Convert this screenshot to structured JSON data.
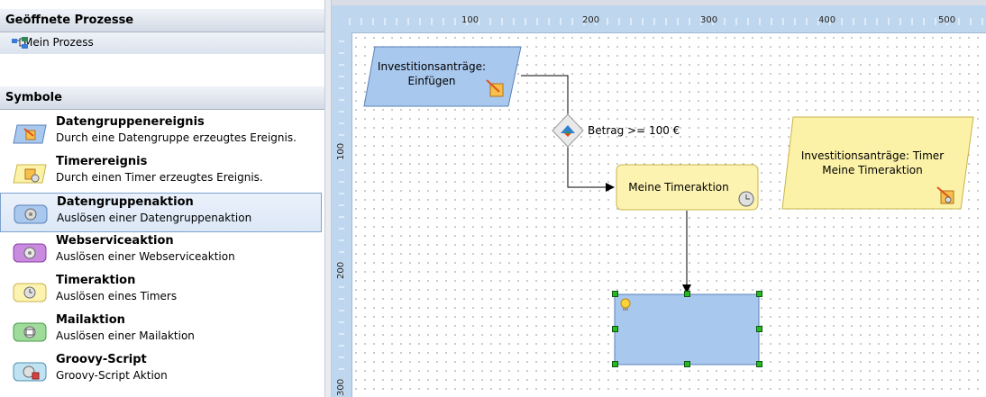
{
  "processes": {
    "header": "Geöffnete Prozesse",
    "items": [
      {
        "label": "Mein Prozess",
        "icon": "process-icon"
      }
    ]
  },
  "symbols": {
    "header": "Symbole",
    "items": [
      {
        "title": "Datengruppenereignis",
        "desc": "Durch eine Datengruppe erzeugtes Ereignis.",
        "icon": "datagroup-event-icon",
        "selected": false
      },
      {
        "title": "Timerereignis",
        "desc": "Durch einen Timer erzeugtes Ereignis.",
        "icon": "timer-event-icon",
        "selected": false
      },
      {
        "title": "Datengruppenaktion",
        "desc": "Auslösen einer Datengruppenaktion",
        "icon": "datagroup-action-icon",
        "selected": true
      },
      {
        "title": "Webserviceaktion",
        "desc": "Auslösen einer Webserviceaktion",
        "icon": "webservice-action-icon",
        "selected": false
      },
      {
        "title": "Timeraktion",
        "desc": "Auslösen eines Timers",
        "icon": "timer-action-icon",
        "selected": false
      },
      {
        "title": "Mailaktion",
        "desc": "Auslösen einer Mailaktion",
        "icon": "mail-action-icon",
        "selected": false
      },
      {
        "title": "Groovy-Script",
        "desc": "Groovy-Script Aktion",
        "icon": "groovy-script-icon",
        "selected": false
      }
    ]
  },
  "ruler": {
    "h_labels": [
      "100",
      "200",
      "300",
      "400",
      "500"
    ],
    "v_labels": [
      "100",
      "200",
      "300"
    ]
  },
  "diagram": {
    "event1_line1": "Investitionsanträge:",
    "event1_line2": "Einfügen",
    "condition": "Betrag >= 100 €",
    "timer_action": "Meine Timeraktion",
    "event2_line1": "Investitionsanträge: Timer",
    "event2_line2": "Meine Timeraktion"
  },
  "colors": {
    "event_blue": "#a9c8ee",
    "event_yellow": "#fbf2a8",
    "action_yellow": "#fdf3b0",
    "selected_blue": "#a9c8ee",
    "handle_green": "#22bb22"
  }
}
